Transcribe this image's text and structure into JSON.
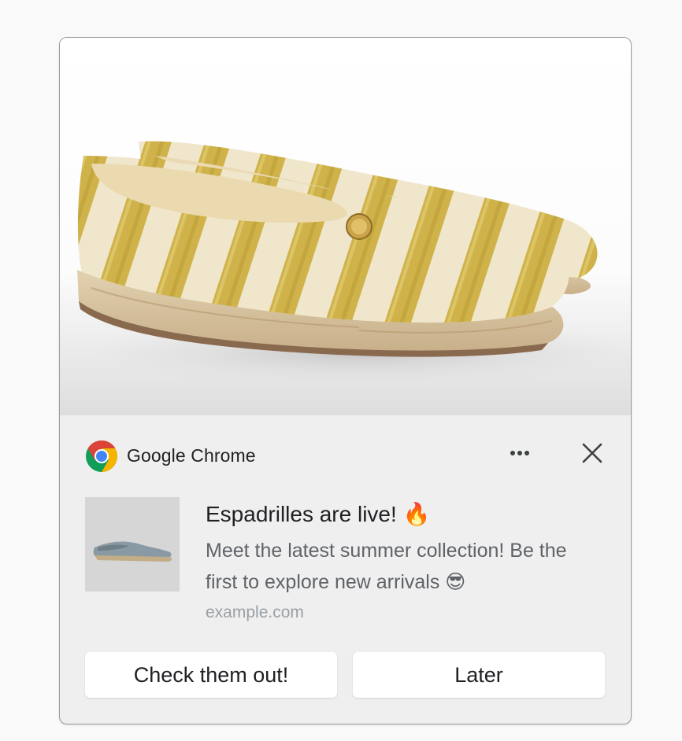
{
  "notification": {
    "hero_image": "espadrilles-striped-gold-shoes",
    "app_icon": "chrome-icon",
    "app_name": "Google Chrome",
    "more_icon": "more-horizontal-icon",
    "close_icon": "close-icon",
    "thumbnail": "grey-espadrille-thumbnail",
    "title": "Espadrilles are live! 🔥",
    "body": "Meet the latest summer collection! Be the first to explore new arrivals 😎",
    "origin": "example.com",
    "actions": [
      {
        "label": "Check them out!"
      },
      {
        "label": "Later"
      }
    ]
  },
  "colors": {
    "card_background": "#efefef",
    "button_background": "#ffffff",
    "title_text": "#202124",
    "body_text": "#5f6368",
    "origin_text": "#9aa0a6",
    "chrome_red": "#db4437",
    "chrome_yellow": "#f4b400",
    "chrome_green": "#0f9d58",
    "chrome_blue": "#4285f4"
  }
}
